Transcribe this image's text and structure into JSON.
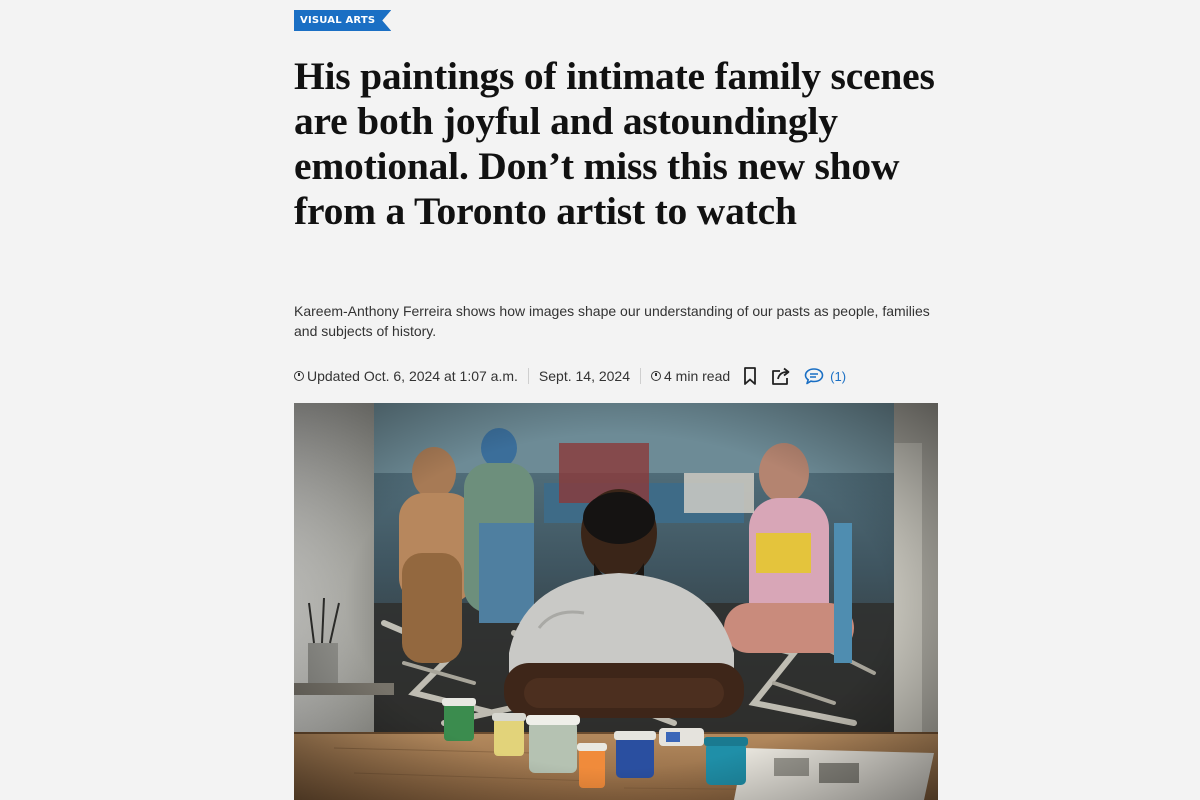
{
  "section": {
    "label": "VISUAL ARTS",
    "color": "#1a6fc4"
  },
  "headline": "His paintings of intimate family scenes are both joyful and astoundingly emotional. Don’t miss this new show from a Toronto artist to watch",
  "dek": "Kareem-Anthony Ferreira shows how images shape our understanding of our pasts as people, families and subjects of history.",
  "meta": {
    "updated": "Updated Oct. 6, 2024 at 1:07 a.m.",
    "published": "Sept. 14, 2024",
    "read_time": "4 min read",
    "comments": "(1)",
    "icons": [
      "clock-icon",
      "bookmark-icon",
      "share-icon",
      "comment-icon"
    ]
  },
  "image": {
    "subject": "photo-artist-in-studio",
    "accent_colors": [
      "#c9a27e",
      "#e8a9c6",
      "#2e6f8e",
      "#b58d5c"
    ]
  }
}
